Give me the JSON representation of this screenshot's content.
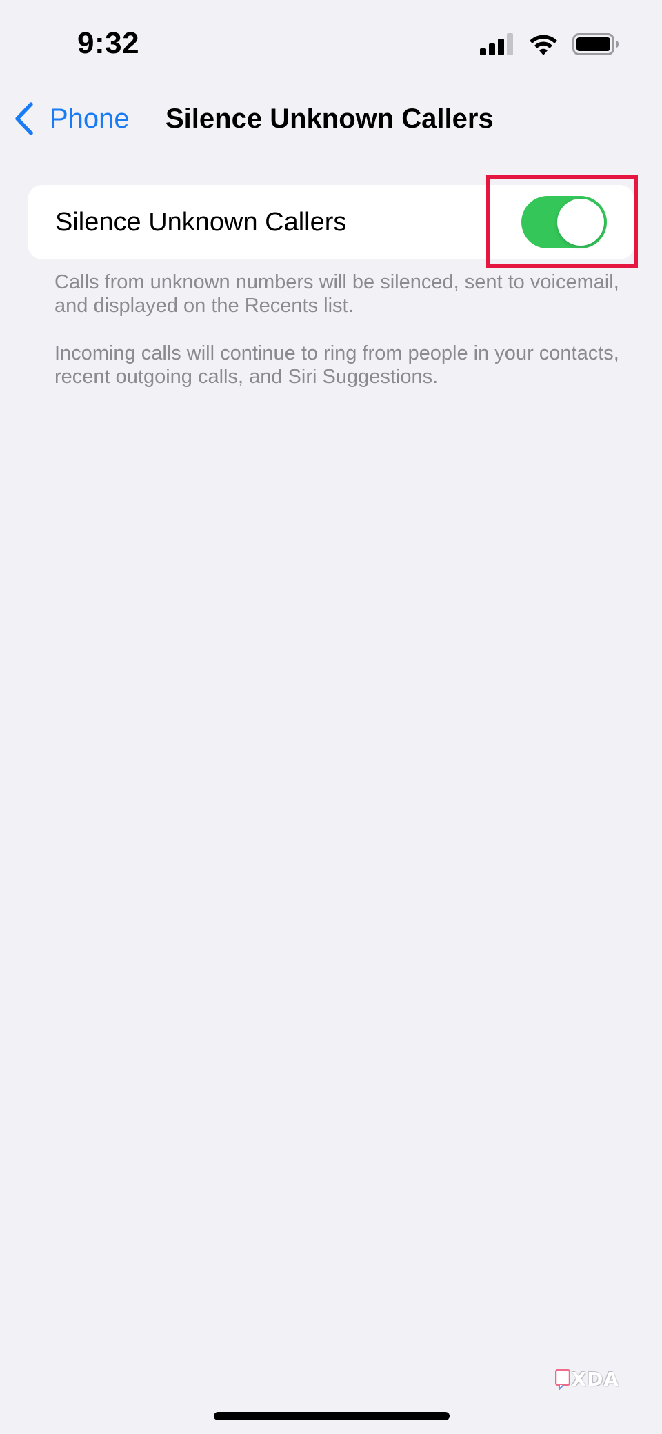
{
  "status_bar": {
    "time": "9:32",
    "icons": [
      "signal-icon",
      "wifi-icon",
      "battery-icon"
    ]
  },
  "nav": {
    "back_label": "Phone",
    "back_icon": "chevron-left-icon",
    "title": "Silence Unknown Callers"
  },
  "setting": {
    "label": "Silence Unknown Callers",
    "toggle_on": true
  },
  "footer": {
    "line1": "Calls from unknown numbers will be silenced, sent to voicemail, and displayed on the Recents list.",
    "line2": "Incoming calls will continue to ring from people in your contacts, recent outgoing calls, and Siri Suggestions."
  },
  "watermark": {
    "text": "XDA"
  },
  "colors": {
    "background": "#f2f1f6",
    "accent_blue": "#1a7cf5",
    "toggle_green": "#34c659",
    "highlight_red": "#e5163f",
    "footer_gray": "#8a8a8f"
  }
}
